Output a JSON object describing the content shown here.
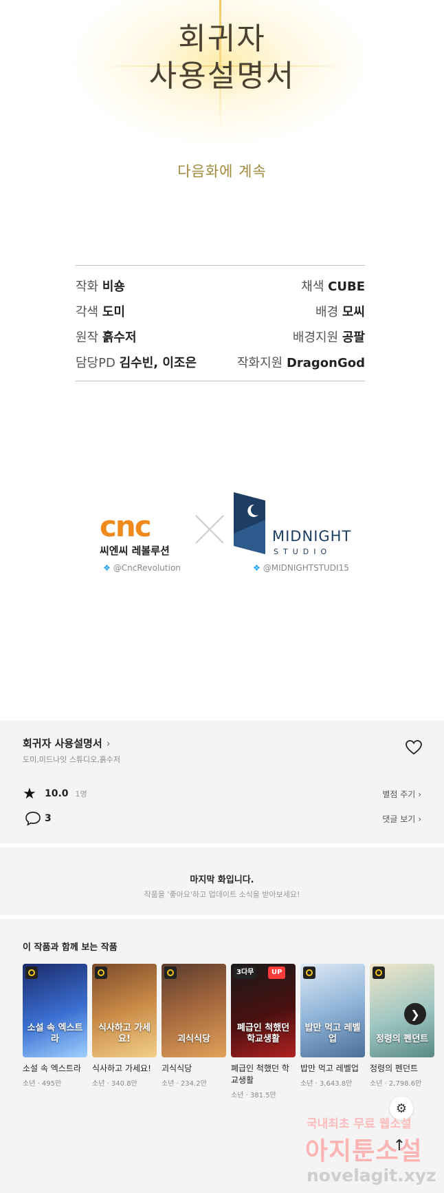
{
  "art": {
    "title_line1": "회귀자",
    "title_line2": "사용설명서",
    "continue_text": "다음화에 계속"
  },
  "credits": [
    {
      "left_key": "작화",
      "left_val": "비숑",
      "right_key": "채색",
      "right_val": "CUBE"
    },
    {
      "left_key": "각색",
      "left_val": "도미",
      "right_key": "배경",
      "right_val": "모씨"
    },
    {
      "left_key": "원작",
      "left_val": "흙수저",
      "right_key": "배경지원",
      "right_val": "공팔"
    },
    {
      "left_key": "담당PD",
      "left_val": "김수빈, 이조은",
      "right_key": "작화지원",
      "right_val": "DragonGod"
    }
  ],
  "studios": {
    "cnc_logo": "cnc",
    "cnc_korean": "씨엔씨 레볼루션",
    "cnc_twitter": "@CncRevolution",
    "midnight_name": "MIDNIGHT",
    "midnight_sub": "STUDIO",
    "midnight_twitter": "@MIDNIGHTSTUDI15"
  },
  "series": {
    "title": "회귀자 사용설명서",
    "authors": "도미,미드나잇 스튜디오,흙수저",
    "rating": "10.0",
    "rating_count": "1명",
    "rate_link": "별점 주기",
    "comment_count": "3",
    "comment_link": "댓글 보기"
  },
  "last_episode": {
    "title": "마지막 화입니다.",
    "subtitle": "작품을 '좋아요'하고 업데이트 소식을 받아보세요!"
  },
  "recommendations": {
    "heading": "이 작품과 함께 보는 작품",
    "items": [
      {
        "title": "소설 속 엑스트라",
        "meta": "소년 · 495만",
        "cover_text": "소설 속 엑스트라",
        "badge": "clock"
      },
      {
        "title": "식사하고 가세요!",
        "meta": "소년 · 340.8만",
        "cover_text": "식사하고 가세요!",
        "badge": "clock"
      },
      {
        "title": "괴식식당",
        "meta": "소년 · 234.2만",
        "cover_text": "괴식식당",
        "badge": "clock"
      },
      {
        "title": "폐급인 척했던 학교생활",
        "meta": "소년 · 381.5만",
        "cover_text": "폐급인 척했던 학교생활",
        "badge": "3다무",
        "up": "UP"
      },
      {
        "title": "밥만 먹고 레벨업",
        "meta": "소년 · 3,643.8만",
        "cover_text": "밥만 먹고 레벨업",
        "badge": "clock"
      },
      {
        "title": "정령의 펜던트",
        "meta": "소년 · 2,798.6만",
        "cover_text": "정령의 펜던트",
        "badge": "clock"
      }
    ]
  },
  "watermark": {
    "line1": "국내최초 무료 웹소설",
    "line2": "아지툰소설",
    "line3": "novelagit.xyz"
  },
  "colors": {
    "accent_gold": "#a18a3e",
    "cnc_orange": "#f18a1d",
    "midnight_navy": "#1d3d62",
    "panel_bg": "#f4f4f4"
  }
}
